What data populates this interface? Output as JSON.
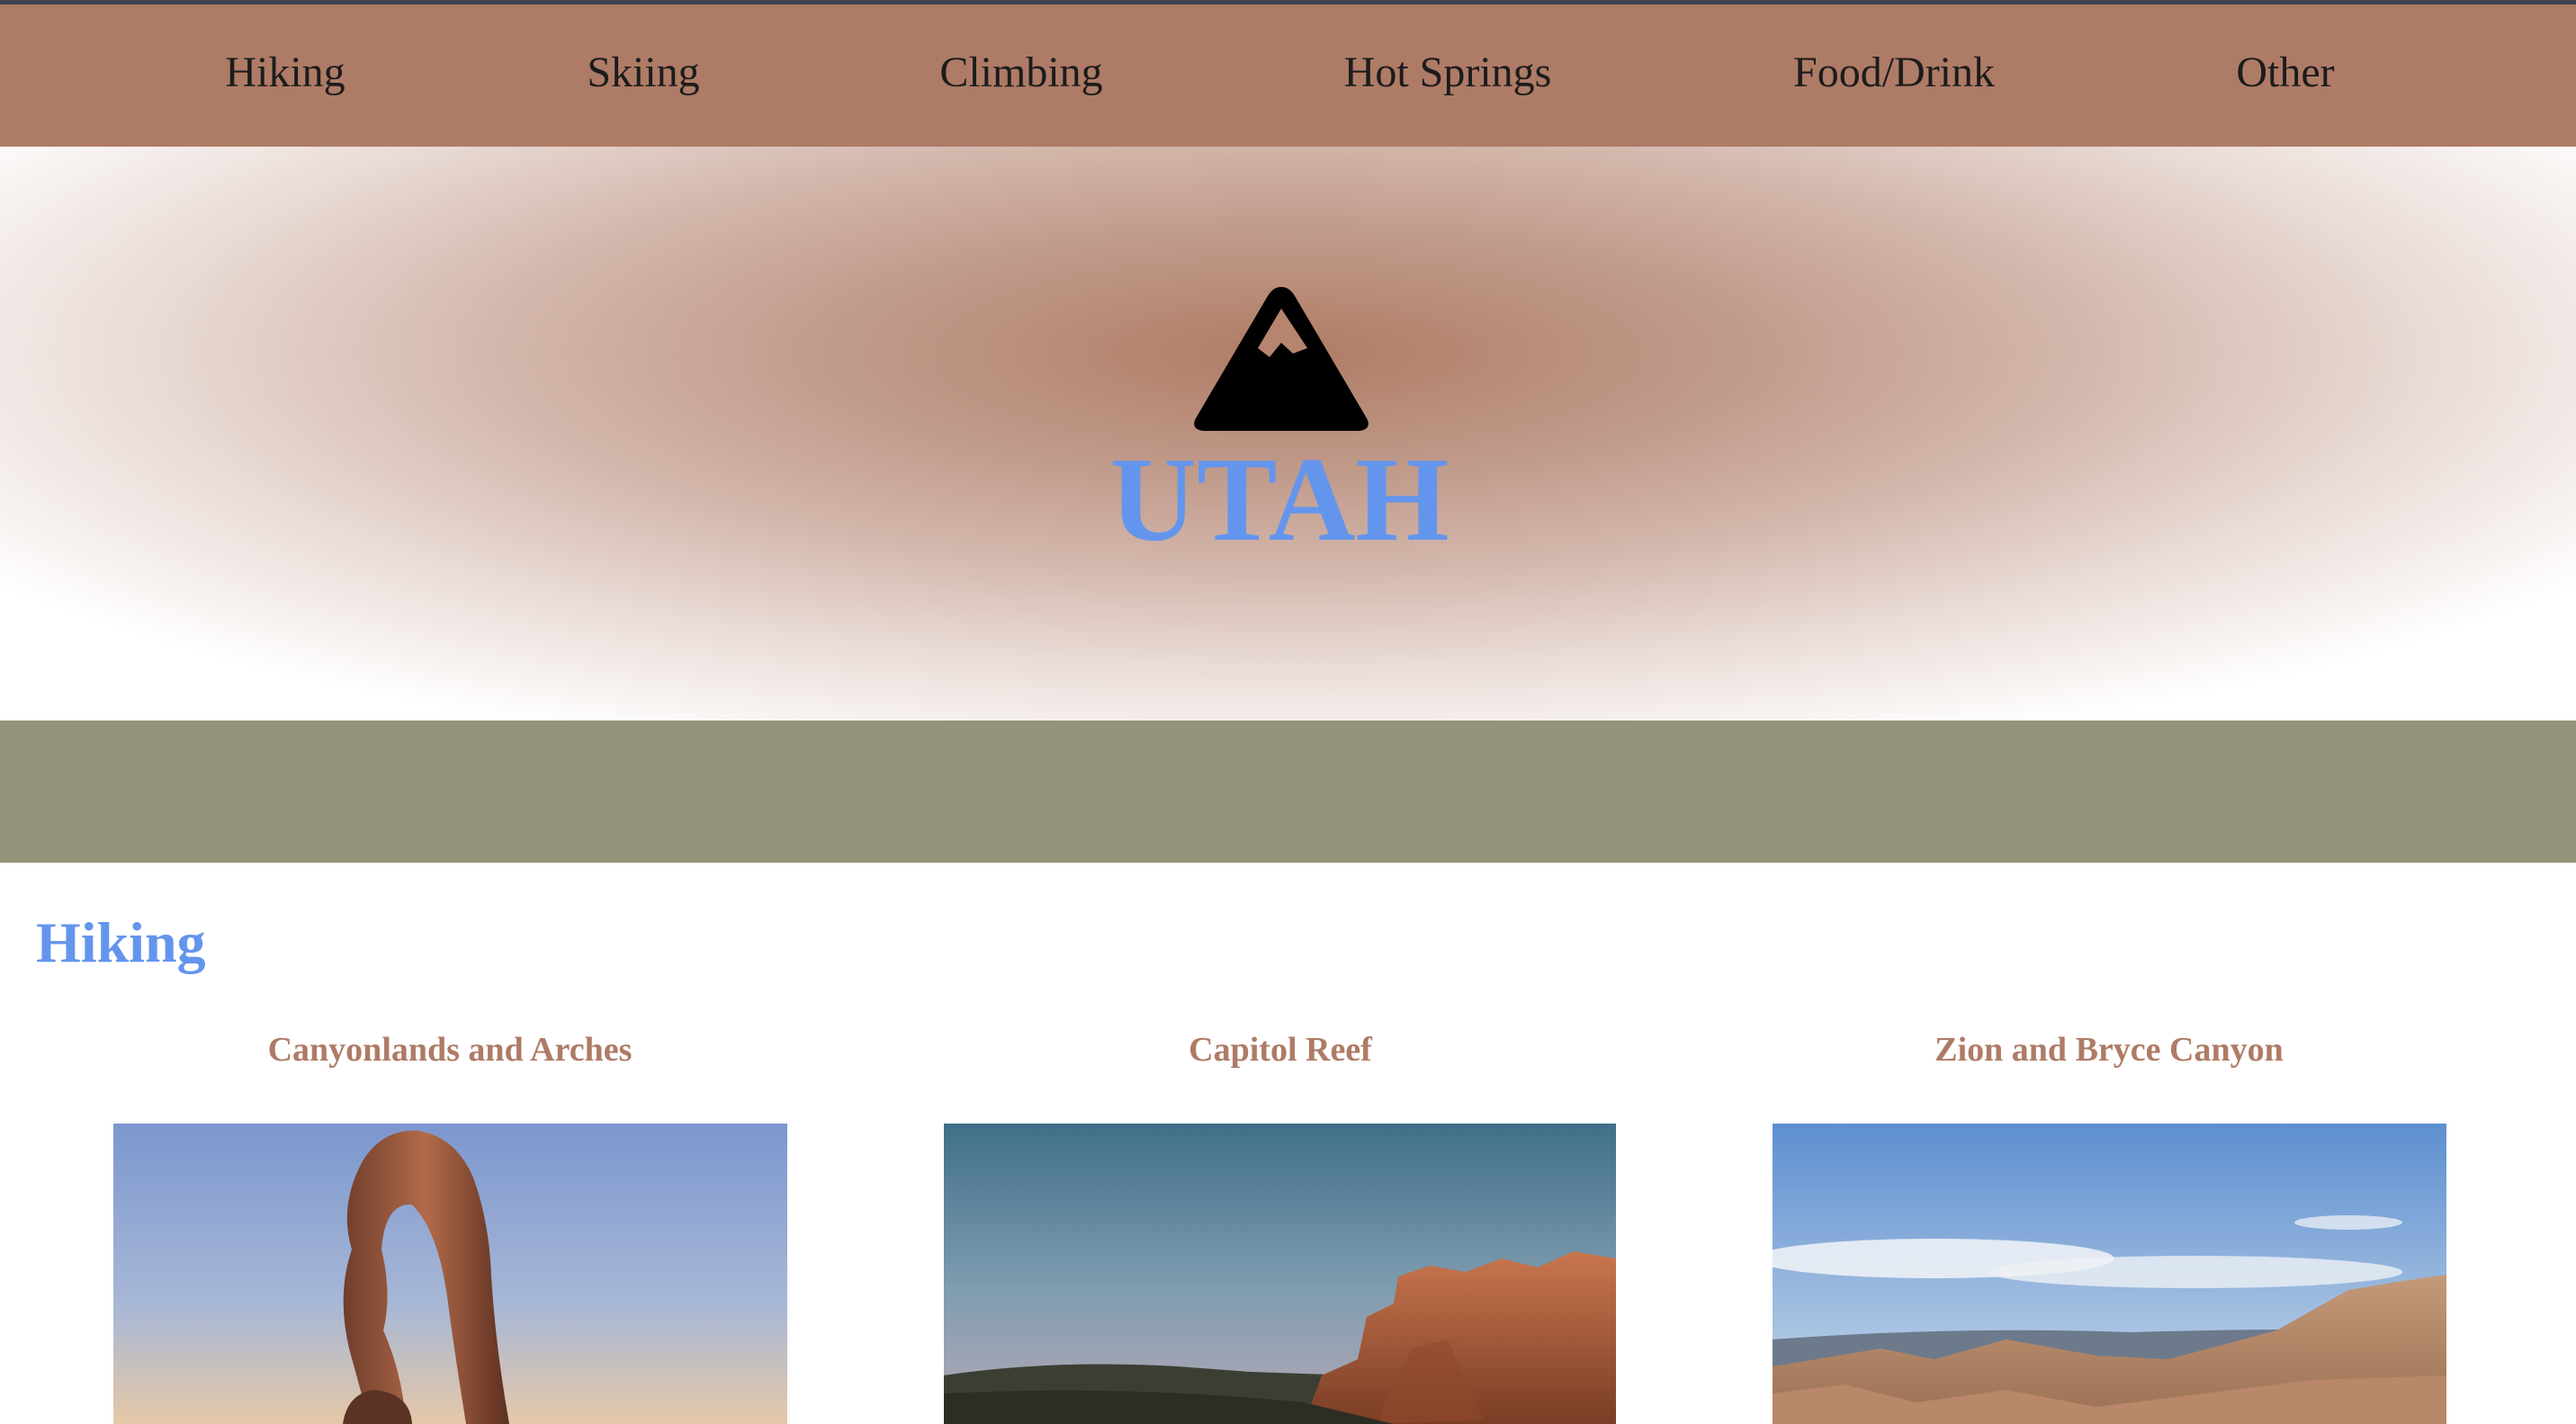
{
  "nav": {
    "items": [
      {
        "label": "Hiking"
      },
      {
        "label": "Skiing"
      },
      {
        "label": "Climbing"
      },
      {
        "label": "Hot Springs"
      },
      {
        "label": "Food/Drink"
      },
      {
        "label": "Other"
      }
    ]
  },
  "hero": {
    "icon": "mountain-icon",
    "title": "UTAH"
  },
  "section": {
    "heading": "Hiking"
  },
  "cards": [
    {
      "title": "Canyonlands and Arches",
      "image": "delicate-arch-photo"
    },
    {
      "title": "Capitol Reef",
      "image": "capitol-reef-cliffs-photo"
    },
    {
      "title": "Zion and Bryce Canyon",
      "image": "bryce-canyon-hoodoos-photo"
    }
  ],
  "colors": {
    "nav_background": "#ae7b66",
    "accent_blue": "#6495ed",
    "card_title": "#ae7b66",
    "band_green": "#929378"
  }
}
